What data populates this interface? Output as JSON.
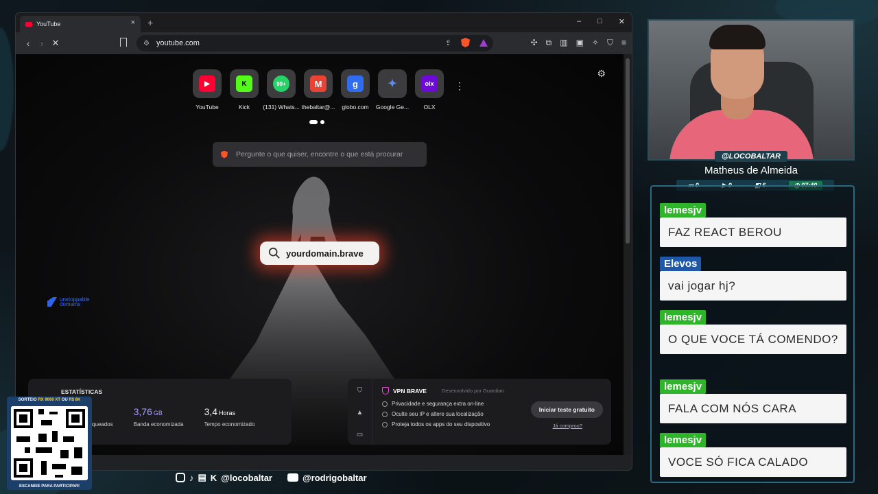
{
  "browser": {
    "tab_title": "YouTube",
    "url": "youtube.com",
    "new_tab_glyph": "+",
    "tab_close_glyph": "×",
    "window_controls": [
      "–",
      "□",
      "✕"
    ],
    "back_glyph": "‹",
    "forward_glyph": "›",
    "stop_glyph": "✕"
  },
  "newtab": {
    "top_sites": [
      {
        "label": "YouTube",
        "icon": "youtube-icon",
        "color": "#ff0033",
        "glyph": "▶"
      },
      {
        "label": "Kick",
        "icon": "kick-icon",
        "color": "#53fc18",
        "glyph": "K"
      },
      {
        "label": "(131) Whats...",
        "icon": "whatsapp-icon",
        "color": "#25d366",
        "glyph": "99+"
      },
      {
        "label": "thebaltar@...",
        "icon": "gmail-icon",
        "color": "#ea4335",
        "glyph": "M"
      },
      {
        "label": "globo.com",
        "icon": "globo-icon",
        "color": "#2f6cf0",
        "glyph": "g"
      },
      {
        "label": "Google Ge...",
        "icon": "gemini-icon",
        "color": "#5b8def",
        "glyph": "✦"
      },
      {
        "label": "OLX",
        "icon": "olx-icon",
        "color": "#6e0ad6",
        "glyph": "olx"
      }
    ],
    "search_placeholder": "Pergunte o que quiser, encontre o que está procurar",
    "domain_pill": "yourdomain.brave",
    "sponsor_logo": [
      "unstoppable",
      "domains"
    ],
    "stats": {
      "title": "ESTATÍSTICAS",
      "items": [
        {
          "value": "",
          "unit": "",
          "caption": "anúncios bloqueados",
          "color": "#ffffff"
        },
        {
          "value": "3,76",
          "unit": "GB",
          "caption": "Banda economizada",
          "color": "#a89cff"
        },
        {
          "value": "3,4",
          "unit": "Horas",
          "caption": "Tempo economizado",
          "color": "#f2f2f2"
        }
      ]
    },
    "vpn": {
      "title": "VPN BRAVE",
      "developed_by": "Desenvolvido por  Guardian",
      "features": [
        "Privacidade e segurança extra on-line",
        "Oculte seu IP e altere sua localização",
        "Proteja todos os apps do seu dispositivo"
      ],
      "trial_button": "Iniciar teste gratuito",
      "already_bought": "Já comprou?"
    }
  },
  "stream": {
    "handle": "@LOCOBALTAR",
    "name": "Matheus de Almeida",
    "counters": [
      "0",
      "0",
      "6"
    ],
    "timer": "07:40",
    "chat": [
      {
        "user": "lemesjv",
        "user_color": "#2fb52a",
        "text": "FAZ REACT BEROU"
      },
      {
        "user": "Elevos",
        "user_color": "#1f58a8",
        "text": "vai jogar hj?"
      },
      {
        "user": "lemesjv",
        "user_color": "#2fb52a",
        "text": "O QUE VOCE TÁ COMENDO?"
      },
      {
        "user": "lemesjv",
        "user_color": "#2fb52a",
        "text": "FALA COM NÓS CARA"
      },
      {
        "user": "lemesjv",
        "user_color": "#2fb52a",
        "text": "VOCE SÓ FICA CALADO"
      }
    ],
    "socials": {
      "handle1": "@locobaltar",
      "handle2": "@rodrigobaltar"
    },
    "promo": {
      "top_prefix": "SORTEIO",
      "top_highlight": "RX 9060 XT",
      "top_mid": "OU",
      "top_highlight2": "R$ 8K",
      "bottom": "ESCANEIE PARA PARTICIPAR!"
    }
  }
}
